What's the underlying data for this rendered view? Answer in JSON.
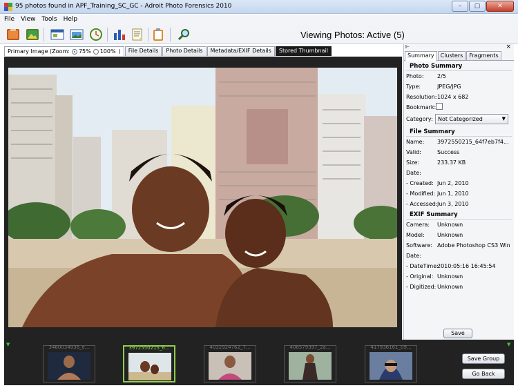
{
  "window": {
    "title": "95 photos found in APF_Training_SC_GC - Adroit Photo Forensics 2010",
    "min_label": "–",
    "max_label": "▢",
    "close_label": "✕"
  },
  "menu": [
    "File",
    "View",
    "Tools",
    "Help"
  ],
  "toolbar": {
    "icons": [
      "folder-icon",
      "photo-icon",
      "window-icon",
      "image-window-icon",
      "clock-icon",
      "bar-chart-icon",
      "notes-icon",
      "clipboard-icon",
      "search-icon"
    ]
  },
  "viewing_label": "Viewing Photos: Active (5)",
  "image_tabs": {
    "primary_label": "Primary Image (Zoom:",
    "zoom_75": "75%",
    "zoom_100": "100%",
    "close_paren": ")",
    "tabs": [
      "File Details",
      "Photo Details",
      "Metadata/EXIF Details",
      "Stored Thumbnail"
    ]
  },
  "panel": {
    "pin_label": "⊩",
    "close_label": "×",
    "tabs": [
      "Summary",
      "Clusters",
      "Fragments"
    ],
    "photo_summary": {
      "title": "Photo Summary",
      "photo_k": "Photo:",
      "photo_v": "2/5",
      "type_k": "Type:",
      "type_v": "JPEG/JPG",
      "res_k": "Resolution:",
      "res_v": "1024 x 682",
      "bookmark_k": "Bookmark:",
      "category_k": "Category:",
      "category_v": "Not Categorized"
    },
    "file_summary": {
      "title": "File Summary",
      "name_k": "Name:",
      "name_v": "3972550215_64f7eb7f4...",
      "valid_k": "Valid:",
      "valid_v": "Success",
      "size_k": "Size:",
      "size_v": "233.37 KB",
      "date_k": "Date:",
      "created_k": " - Created:",
      "created_v": "Jun 2, 2010",
      "modified_k": " - Modified:",
      "modified_v": "Jun 1, 2010",
      "accessed_k": " - Accessed:",
      "accessed_v": "Jun 3, 2010"
    },
    "exif_summary": {
      "title": "EXIF Summary",
      "camera_k": "Camera:",
      "camera_v": "Unknown",
      "model_k": "Model:",
      "model_v": "Unknown",
      "software_k": "Software:",
      "software_v": "Adobe Photoshop CS3 Win...",
      "date_k": "Date:",
      "datetime_k": " - DateTime:",
      "datetime_v": "2010:05:16 16:45:54",
      "original_k": " - Original:",
      "original_v": "Unknown",
      "digitized_k": " - Digitized:",
      "digitized_v": "Unknown"
    },
    "save_label": "Save"
  },
  "filmstrip": {
    "marker": "▼",
    "thumbs": [
      {
        "caption": "3460034936_e..."
      },
      {
        "caption": "3972550215_6..."
      },
      {
        "caption": "4032924762_7..."
      },
      {
        "caption": "408579397_2a..."
      },
      {
        "caption": "417936161_09..."
      }
    ],
    "save_group_label": "Save Group",
    "go_back_label": "Go Back"
  }
}
